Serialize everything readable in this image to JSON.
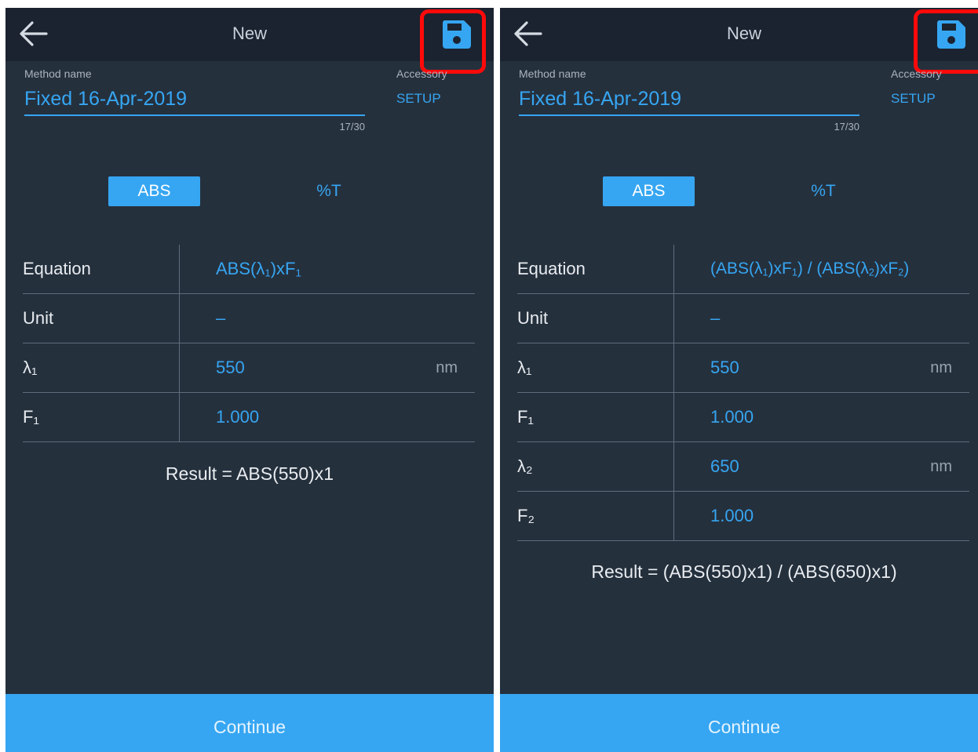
{
  "colors": {
    "accent": "#36a6f2",
    "background": "#25303d",
    "topbar": "#1b2330",
    "highlight": "#ff0a0a"
  },
  "icons": {
    "back": "back-arrow-icon",
    "save": "floppy-disk-save-icon"
  },
  "screens": [
    {
      "topbar": {
        "title": "New"
      },
      "method": {
        "label": "Method name",
        "value": "Fixed 16-Apr-2019",
        "char_count": "17/30"
      },
      "accessory": {
        "label": "Accessory",
        "setup_label": "SETUP"
      },
      "mode_toggle": {
        "abs_label": "ABS",
        "t_label": "%T",
        "selected": "ABS"
      },
      "equation": {
        "label": "Equation"
      },
      "unit": {
        "label": "Unit",
        "value": "–"
      },
      "lambda1": {
        "label": "λ₁",
        "value": "550",
        "unit": "nm"
      },
      "f1": {
        "label": "F₁",
        "value": "1.000"
      },
      "result": "Result = ABS(550)x1",
      "continue_label": "Continue"
    },
    {
      "topbar": {
        "title": "New"
      },
      "method": {
        "label": "Method name",
        "value": "Fixed 16-Apr-2019",
        "char_count": "17/30"
      },
      "accessory": {
        "label": "Accessory",
        "setup_label": "SETUP"
      },
      "mode_toggle": {
        "abs_label": "ABS",
        "t_label": "%T",
        "selected": "ABS"
      },
      "equation": {
        "label": "Equation"
      },
      "unit": {
        "label": "Unit",
        "value": "–"
      },
      "lambda1": {
        "label": "λ₁",
        "value": "550",
        "unit": "nm"
      },
      "f1": {
        "label": "F₁",
        "value": "1.000"
      },
      "lambda2": {
        "label": "λ₂",
        "value": "650",
        "unit": "nm"
      },
      "f2": {
        "label": "F₂",
        "value": "1.000"
      },
      "result": "Result = (ABS(550)x1) / (ABS(650)x1)",
      "continue_label": "Continue"
    }
  ]
}
